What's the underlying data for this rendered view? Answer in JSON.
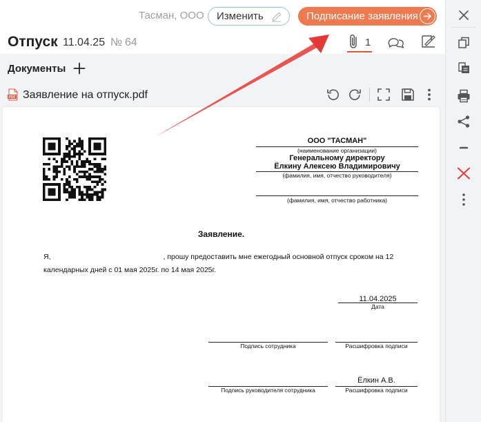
{
  "header": {
    "company": "Тасман, ООО",
    "edit_label": "Изменить",
    "sign_label": "Подписание заявления",
    "title": "Отпуск",
    "date": "11.04.25",
    "number_sign": "№",
    "number": "64",
    "attachments_count": "1"
  },
  "documents": {
    "title": "Документы",
    "file_name": "Заявление на отпуск.pdf",
    "toolbar_icons": [
      "rotate-left-icon",
      "rotate-right-icon",
      "fullscreen-icon",
      "save-icon",
      "more-vertical-icon"
    ]
  },
  "document": {
    "org_name": "ООО \"ТАСМАН\"",
    "org_caption": "(наименование организации)",
    "addressee_title": "Генеральному директору",
    "addressee_name": "Ёлкину Алексею Владимировичу",
    "director_caption": "(фамилия, имя, отчество руководителя)",
    "employee_caption": "(фамилия, имя, отчество работника)",
    "statement_title": "Заявление.",
    "line1_prefix": "Я,",
    "line1_suffix": ", прошу предоставить мне ежегодный основной отпуск сроком на 12",
    "line2": "календарных дней с 01 мая 2025г. по 14 мая 2025г.",
    "sign_date": "11.04.2025",
    "date_caption": "Дата",
    "employee_sign_caption": "Подпись сотрудника",
    "decode_caption_1": "Расшифровка подписи",
    "manager_sign_caption": "Подпись руководителя сотрудника",
    "manager_name": "Ёлкин А.В.",
    "decode_caption_2": "Расшифровка подписи"
  },
  "right_panel_icons": [
    "close-icon",
    "copy-icon",
    "copy-to-clipboard-icon",
    "print-icon",
    "share-icon",
    "minus-icon",
    "delete-icon",
    "more-vertical-icon"
  ],
  "colors": {
    "accent": "#f07a4f",
    "tab_underline": "#e8542c",
    "delete": "#e53935",
    "arrow": "#e53935"
  }
}
